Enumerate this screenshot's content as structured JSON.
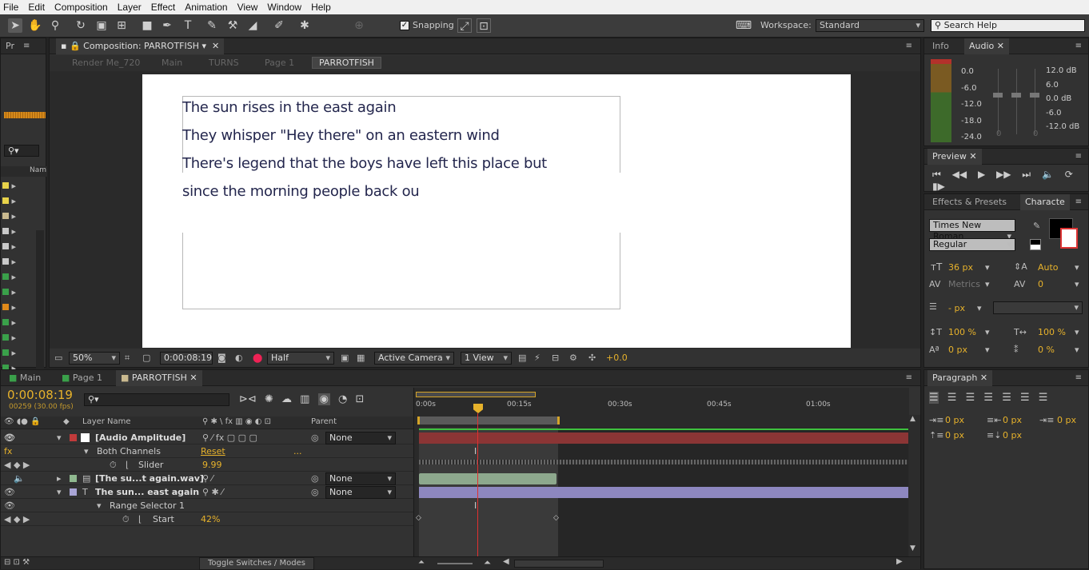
{
  "menu": [
    "File",
    "Edit",
    "Composition",
    "Layer",
    "Effect",
    "Animation",
    "View",
    "Window",
    "Help"
  ],
  "toolbar": {
    "snapping_label": "Snapping",
    "workspace_label": "Workspace:",
    "workspace_value": "Standard",
    "search_placeholder": "Search Help"
  },
  "project": {
    "tab": "Pr"
  },
  "comp_viewer": {
    "panel_title": "Composition: PARROTFISH",
    "breadcrumbs": [
      "Render Me_720",
      "Main",
      "TURNS",
      "Page 1",
      "PARROTFISH"
    ],
    "text_lines": [
      "The sun rises in the east again",
      "They whisper \"Hey there\" on an eastern wind",
      "There's legend that the boys have left this place but",
      "since the morning people back ou"
    ],
    "footer": {
      "zoom": "50%",
      "timecode": "0:00:08:19",
      "resolution": "Half",
      "camera": "Active Camera",
      "views": "1 View",
      "exposure": "+0.0"
    }
  },
  "timeline": {
    "tabs": [
      "Main",
      "Page 1",
      "PARROTFISH"
    ],
    "timecode": "0:00:08:19",
    "frame_info": "00259 (30.00 fps)",
    "col_layer_name": "Layer Name",
    "col_parent": "Parent",
    "ruler": [
      "0:00s",
      "00:15s",
      "00:30s",
      "00:45s",
      "01:00s"
    ],
    "layers": [
      {
        "name": "[Audio Amplitude]",
        "color": "#c23b3b",
        "parent": "None"
      },
      {
        "name": "Both Channels",
        "value": "Reset",
        "extra": "..."
      },
      {
        "name": "Slider",
        "value": "9.99"
      },
      {
        "name": "[The su...t again.wav]",
        "color": "#8fb88f",
        "parent": "None"
      },
      {
        "name": "The sun... east again",
        "color": "#a9a5d6",
        "parent": "None"
      },
      {
        "name": "Range Selector 1"
      },
      {
        "name": "Start",
        "value": "42%"
      }
    ],
    "footer": "Toggle Switches / Modes"
  },
  "info_audio": {
    "tabs": [
      "Info",
      "Audio"
    ],
    "left_scale": [
      "0.0",
      "-6.0",
      "-12.0",
      "-18.0",
      "-24.0"
    ],
    "right_scale": [
      "12.0 dB",
      "6.0",
      "0.0 dB",
      "-6.0",
      "-12.0 dB"
    ],
    "zero_left": "0",
    "zero_right": "0"
  },
  "preview": {
    "title": "Preview"
  },
  "character": {
    "tabs": [
      "Effects & Presets",
      "Characte"
    ],
    "font": "Times New Roman",
    "style": "Regular",
    "size": "36 px",
    "leading": "Auto",
    "kerning": "Metrics",
    "tracking": "0",
    "stroke": "- px",
    "vscale": "100 %",
    "hscale": "100 %",
    "baseline": "0 px",
    "tsume": "0 %"
  },
  "paragraph": {
    "title": "Paragraph",
    "indent_left": "0 px",
    "indent_right": "0 px",
    "indent_first": "0 px",
    "space_before": "0 px",
    "space_after": "0 px"
  },
  "colors": {
    "accent": "#e7b22b",
    "playhead": "#e03030",
    "audio_track": "#8b3535",
    "wav_track": "#8da88d",
    "text_track": "#8d87bf"
  }
}
